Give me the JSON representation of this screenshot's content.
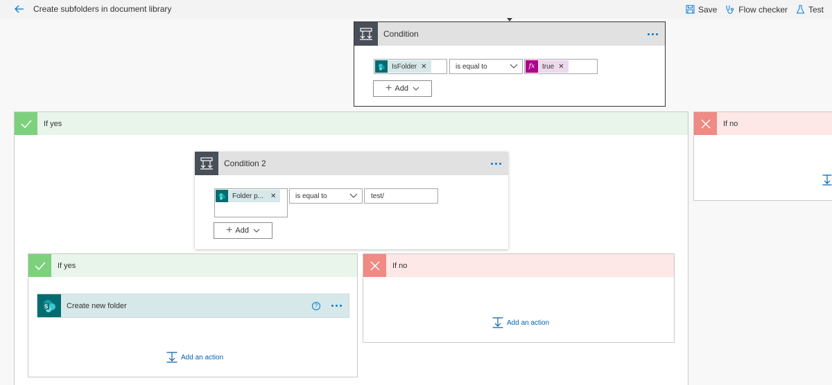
{
  "topbar": {
    "title": "Create subfolders in document library",
    "actions": {
      "save": "Save",
      "flow_checker": "Flow checker",
      "test": "Test"
    }
  },
  "condition1": {
    "title": "Condition",
    "left_token": "IsFolder",
    "operator": "is equal to",
    "right_token": "true",
    "right_token_icon": "fx",
    "add_label": "Add"
  },
  "outer_yes": {
    "label": "If yes"
  },
  "outer_no": {
    "label": "If no"
  },
  "condition2": {
    "title": "Condition 2",
    "left_token": "Folder p...",
    "operator": "is equal to",
    "value": "test/",
    "add_label": "Add"
  },
  "inner_yes": {
    "label": "If yes",
    "action_title": "Create new folder",
    "help": "?",
    "add_action": "Add an action"
  },
  "inner_no": {
    "label": "If no",
    "add_action": "Add an action"
  },
  "colors": {
    "accent": "#0078d4",
    "yes_header": "#e9f5ea",
    "yes_icon": "#7dd17d",
    "no_header": "#fde7e7",
    "no_icon": "#f08a84",
    "sharepoint": "#036c70"
  }
}
